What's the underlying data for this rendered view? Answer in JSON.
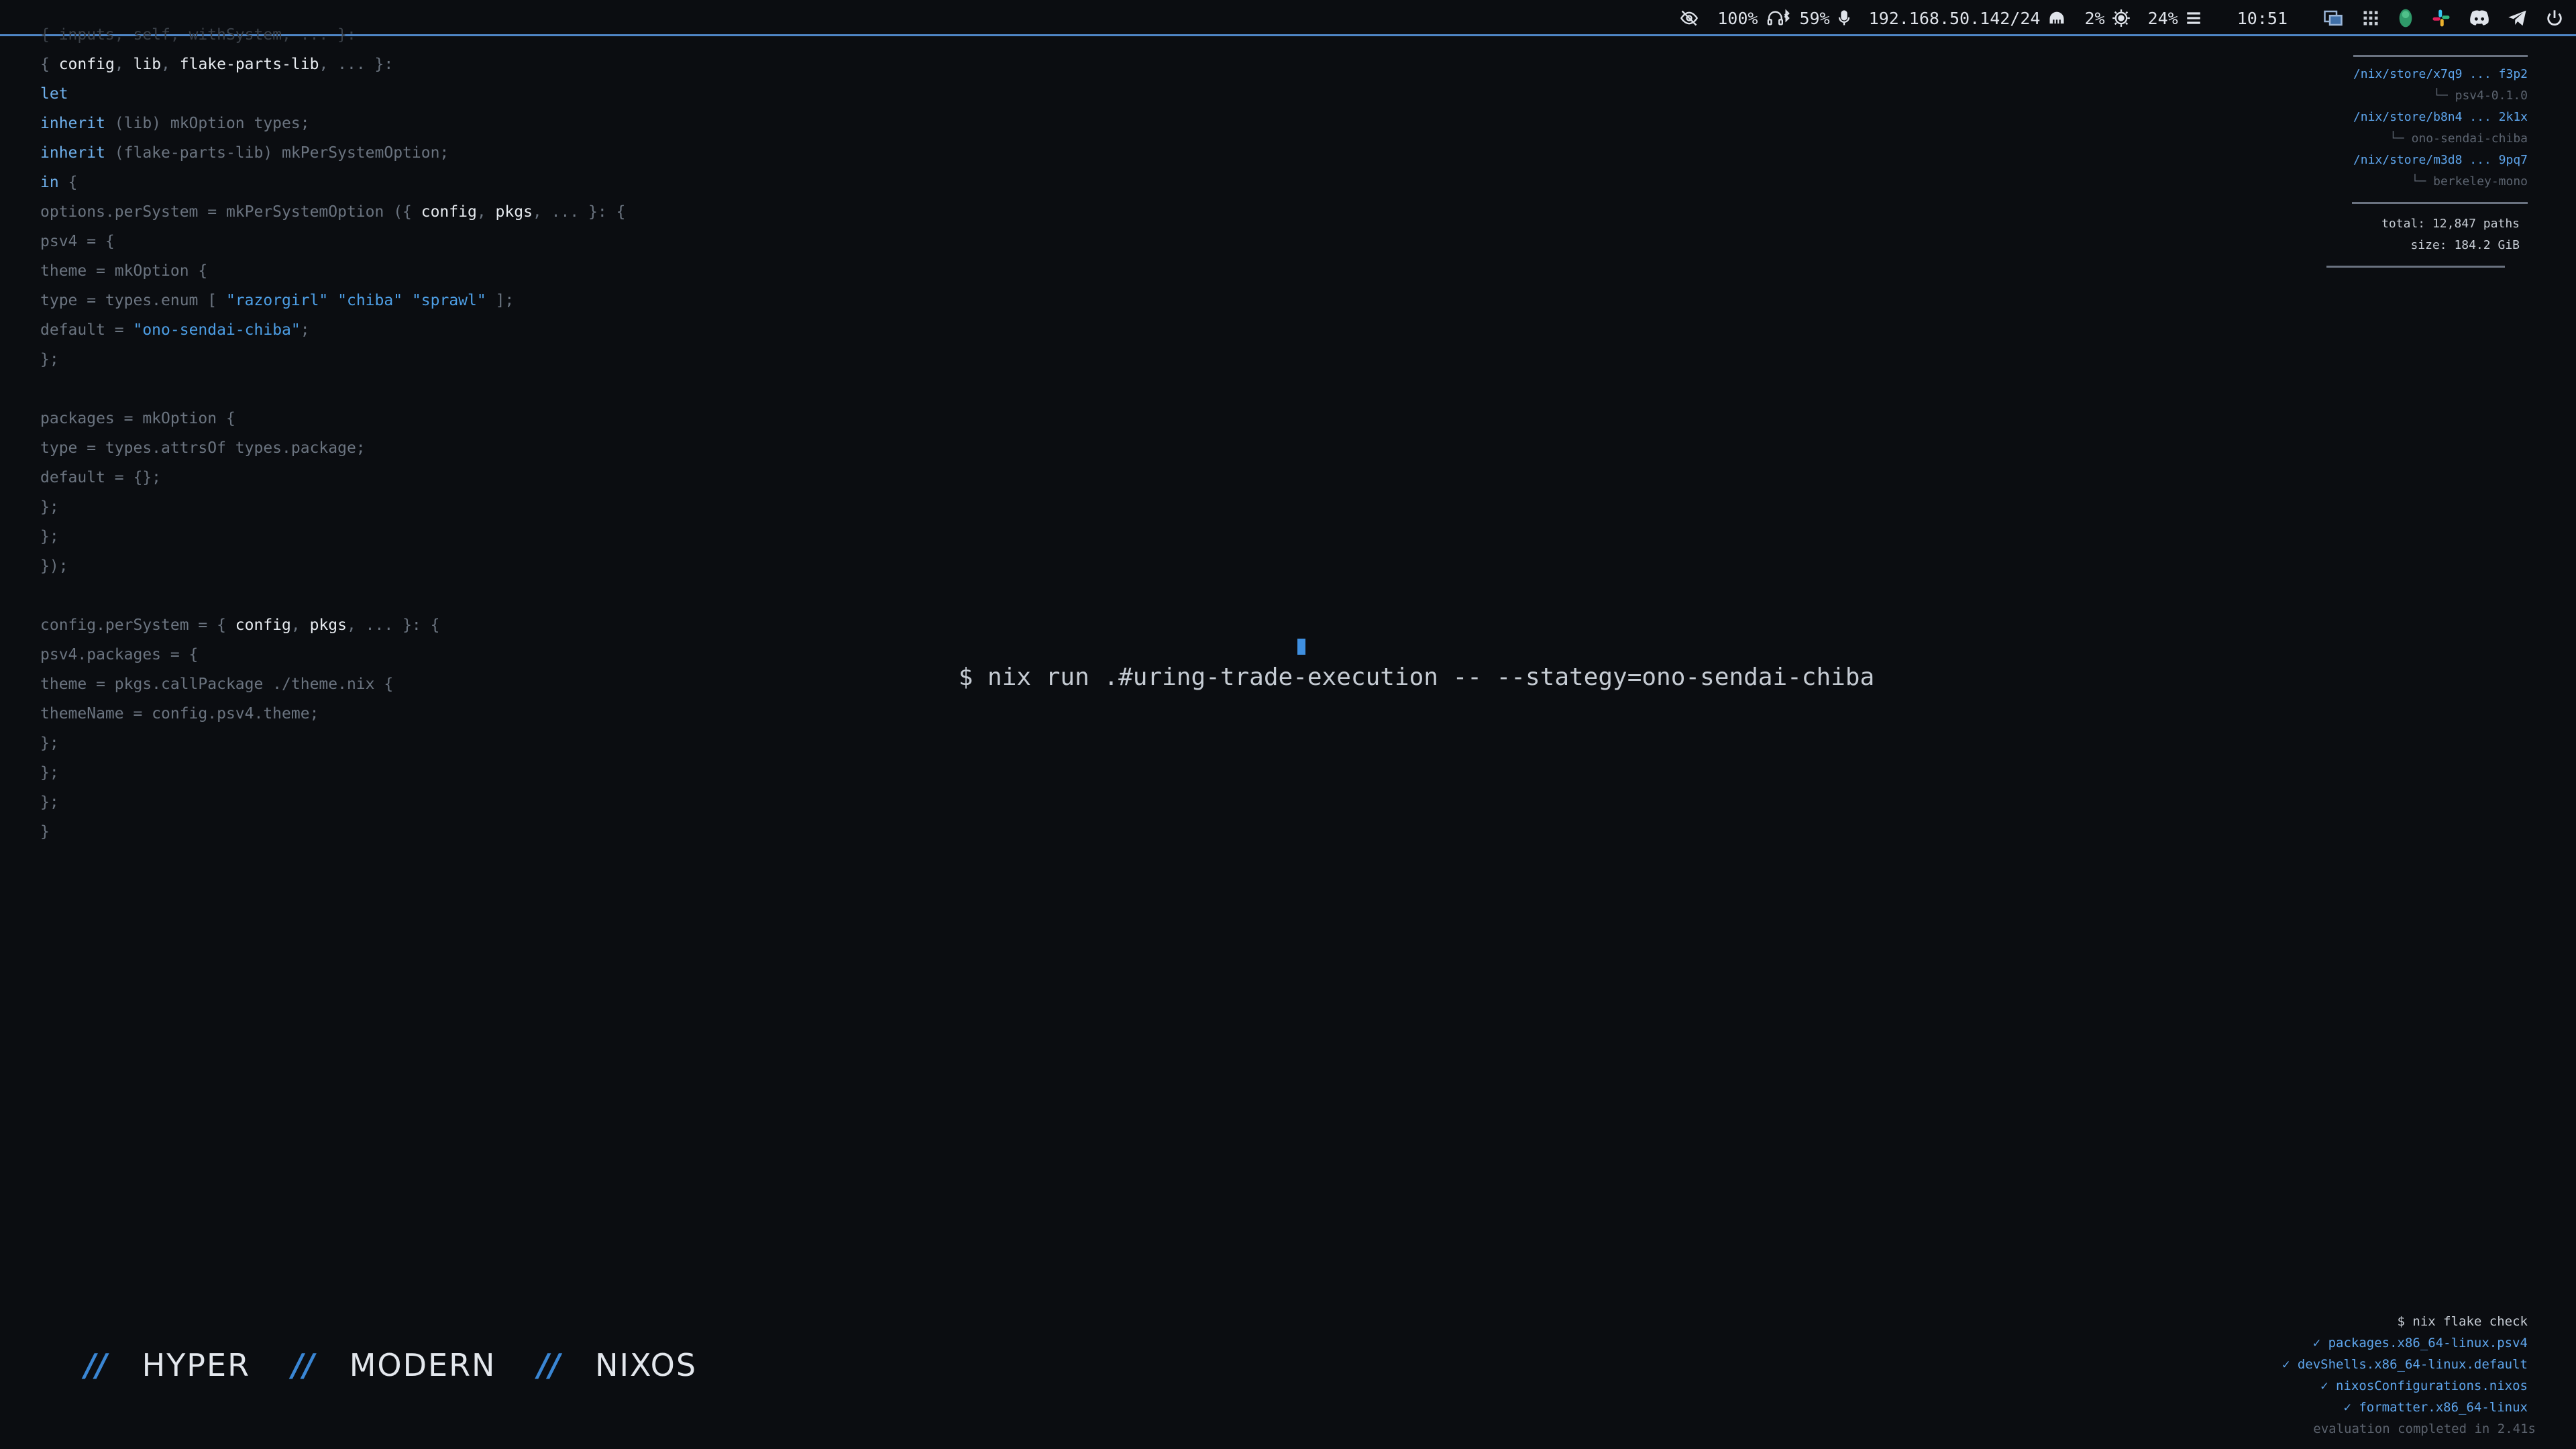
{
  "topbar": {
    "privacy_icon": "eye-off-icon",
    "volume": "100%",
    "bluetooth_icon": "headset-bluetooth-icon",
    "mic_level": "59%",
    "mic_icon": "microphone-icon",
    "ip_address": "192.168.50.142/24",
    "network_icon": "ethernet-icon",
    "cpu": "2%",
    "cpu_icon": "cpu-icon",
    "memory": "24%",
    "memory_icon": "memory-icon",
    "clock": "10:51",
    "tray_icons": [
      "window-switcher-icon",
      "grid-apps-icon",
      "status-shield-icon",
      "slack-icon",
      "discord-icon",
      "telegram-icon",
      "power-icon"
    ],
    "accent": "#4f86c6"
  },
  "code": {
    "lines": [
      {
        "segs": [
          {
            "c": "faded",
            "t": "{ inputs, self, withSystem, ... }:"
          }
        ]
      },
      {
        "segs": [
          {
            "c": "",
            "t": "{ "
          },
          {
            "c": "id",
            "t": "config"
          },
          {
            "c": "",
            "t": ", "
          },
          {
            "c": "id",
            "t": "lib"
          },
          {
            "c": "",
            "t": ", "
          },
          {
            "c": "id",
            "t": "flake-parts-lib"
          },
          {
            "c": "",
            "t": ", ... }:"
          }
        ]
      },
      {
        "segs": [
          {
            "c": "kw",
            "t": "let"
          }
        ]
      },
      {
        "segs": [
          {
            "c": "kw",
            "t": "inherit"
          },
          {
            "c": "",
            "t": " (lib) mkOption types;"
          }
        ]
      },
      {
        "segs": [
          {
            "c": "kw",
            "t": "inherit"
          },
          {
            "c": "",
            "t": " (flake-parts-lib) mkPerSystemOption;"
          }
        ]
      },
      {
        "segs": [
          {
            "c": "kw",
            "t": "in"
          },
          {
            "c": "",
            "t": " {"
          }
        ]
      },
      {
        "segs": [
          {
            "c": "",
            "t": "options.perSystem = mkPerSystemOption ({ "
          },
          {
            "c": "id",
            "t": "config"
          },
          {
            "c": "",
            "t": ", "
          },
          {
            "c": "id",
            "t": "pkgs"
          },
          {
            "c": "",
            "t": ", ... }: {"
          }
        ]
      },
      {
        "segs": [
          {
            "c": "",
            "t": "psv4 = {"
          }
        ]
      },
      {
        "segs": [
          {
            "c": "",
            "t": "theme = mkOption {"
          }
        ]
      },
      {
        "segs": [
          {
            "c": "",
            "t": "type = types.enum [ "
          },
          {
            "c": "str",
            "t": "\"razorgirl\""
          },
          {
            "c": "",
            "t": " "
          },
          {
            "c": "str",
            "t": "\"chiba\""
          },
          {
            "c": "",
            "t": " "
          },
          {
            "c": "str",
            "t": "\"sprawl\""
          },
          {
            "c": "",
            "t": " ];"
          }
        ]
      },
      {
        "segs": [
          {
            "c": "",
            "t": "default = "
          },
          {
            "c": "str",
            "t": "\"ono-sendai-chiba\""
          },
          {
            "c": "",
            "t": ";"
          }
        ]
      },
      {
        "segs": [
          {
            "c": "",
            "t": "};"
          }
        ]
      },
      {
        "segs": [
          {
            "c": "",
            "t": ""
          }
        ]
      },
      {
        "segs": [
          {
            "c": "",
            "t": "packages = mkOption {"
          }
        ]
      },
      {
        "segs": [
          {
            "c": "",
            "t": "type = types.attrsOf types.package;"
          }
        ]
      },
      {
        "segs": [
          {
            "c": "",
            "t": "default = {};"
          }
        ]
      },
      {
        "segs": [
          {
            "c": "",
            "t": "};"
          }
        ]
      },
      {
        "segs": [
          {
            "c": "",
            "t": "};"
          }
        ]
      },
      {
        "segs": [
          {
            "c": "",
            "t": "});"
          }
        ]
      },
      {
        "segs": [
          {
            "c": "",
            "t": ""
          }
        ]
      },
      {
        "segs": [
          {
            "c": "",
            "t": "config.perSystem = { "
          },
          {
            "c": "id",
            "t": "config"
          },
          {
            "c": "",
            "t": ", "
          },
          {
            "c": "id",
            "t": "pkgs"
          },
          {
            "c": "",
            "t": ", ... }: {"
          }
        ]
      },
      {
        "segs": [
          {
            "c": "",
            "t": "psv4.packages = {"
          }
        ]
      },
      {
        "segs": [
          {
            "c": "",
            "t": "theme = pkgs.callPackage ./theme.nix {"
          }
        ]
      },
      {
        "segs": [
          {
            "c": "",
            "t": "themeName = config.psv4.theme;"
          }
        ]
      },
      {
        "segs": [
          {
            "c": "",
            "t": "};"
          }
        ]
      },
      {
        "segs": [
          {
            "c": "",
            "t": "};"
          }
        ]
      },
      {
        "segs": [
          {
            "c": "",
            "t": "};"
          }
        ]
      },
      {
        "segs": [
          {
            "c": "",
            "t": "}"
          }
        ]
      }
    ]
  },
  "command": {
    "text": "$ nix run .#uring-trade-execution -- --stategy=ono-sendai-chiba"
  },
  "store": {
    "entries": [
      {
        "path": "/nix/store/x7q9 ... f3p2",
        "pkg": "└─ psv4-0.1.0"
      },
      {
        "path": "/nix/store/b8n4 ... 2k1x",
        "pkg": "└─ ono-sendai-chiba"
      },
      {
        "path": "/nix/store/m3d8 ... 9pq7",
        "pkg": "└─ berkeley-mono"
      }
    ],
    "total": "total: 12,847 paths",
    "size": "size: 184.2 GiB"
  },
  "check": {
    "command": "$ nix flake check",
    "results": [
      "✓ packages.x86_64-linux.psv4",
      "✓ devShells.x86_64-linux.default",
      "✓ nixosConfigurations.nixos",
      "✓ formatter.x86_64-linux"
    ],
    "footer": "evaluation completed in 2.41s"
  },
  "brand": {
    "slash": "//",
    "words": [
      "HYPER",
      "MODERN",
      "NIXOS"
    ]
  }
}
